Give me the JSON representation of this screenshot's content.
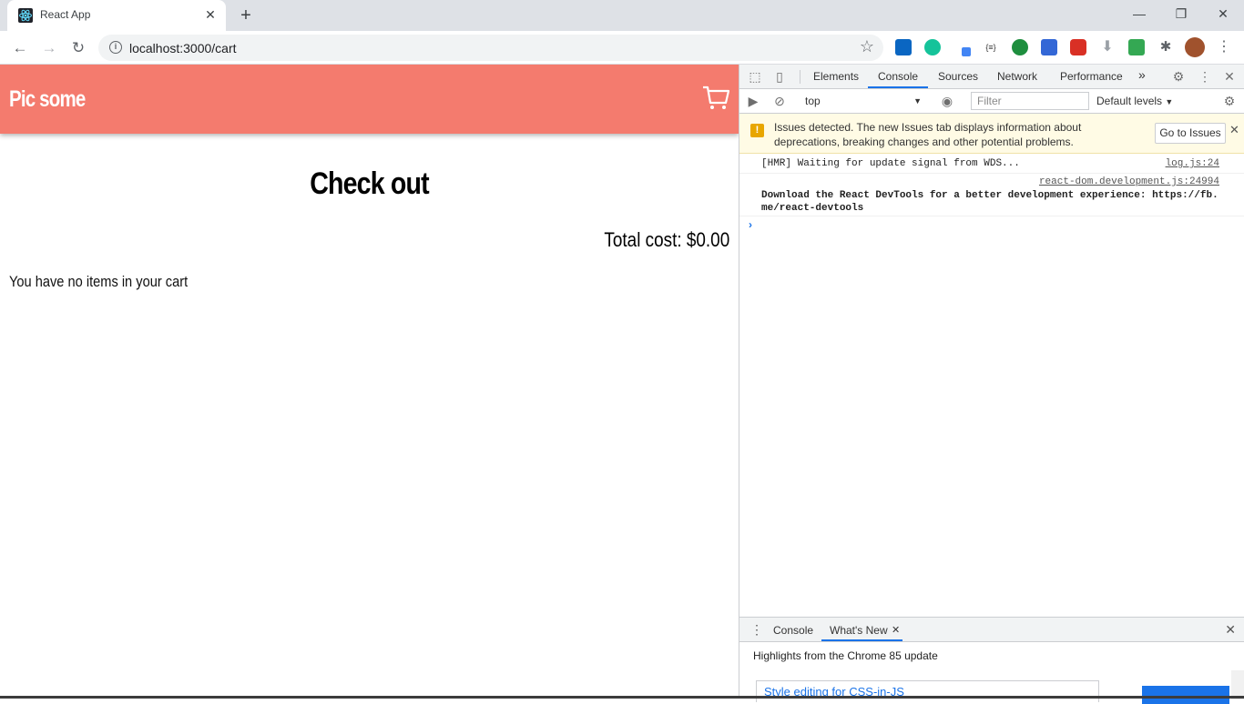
{
  "browser": {
    "tab_title": "React App",
    "url": "localhost:3000/cart",
    "window": {
      "minimize": "—",
      "restore": "❐",
      "close": "✕"
    }
  },
  "page": {
    "brand": "Pic some",
    "heading": "Check out",
    "total": "Total cost: $0.00",
    "empty_message": "You have no items in your cart",
    "header_color": "#f47b6e"
  },
  "devtools": {
    "tabs": [
      "Elements",
      "Console",
      "Sources",
      "Network",
      "Performance"
    ],
    "more": "»",
    "context": "top",
    "filter_placeholder": "Filter",
    "levels": "Default levels",
    "issues_text": "Issues detected. The new Issues tab displays information about deprecations, breaking changes and other potential problems.",
    "go_to_issues": "Go to Issues",
    "logs": [
      {
        "text": "[HMR] Waiting for update signal from WDS...",
        "source": "log.js:24"
      },
      {
        "text": "Download the React DevTools for a better development experience: https://fb.me/react-devtools",
        "source": "react-dom.development.js:24994"
      }
    ],
    "drawer": {
      "tabs": [
        "Console",
        "What's New"
      ],
      "highlights": "Highlights from the Chrome 85 update",
      "card_title": "Style editing for CSS-in-JS"
    }
  }
}
